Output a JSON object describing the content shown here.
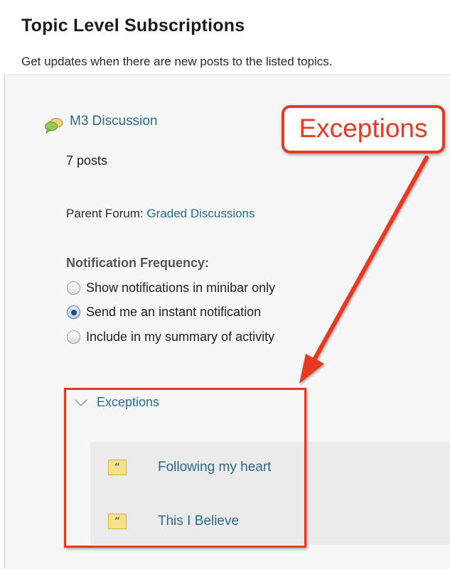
{
  "page": {
    "title": "Topic Level Subscriptions",
    "subtitle": "Get updates when there are new posts to the listed topics."
  },
  "topic": {
    "icon": "discussion-bubbles-icon",
    "name": "M3 Discussion",
    "post_count": "7 posts",
    "parent_forum_label": "Parent Forum:",
    "parent_forum_name": "Graded Discussions"
  },
  "notification": {
    "label": "Notification Frequency:",
    "options": [
      {
        "label": "Show notifications in minibar only",
        "checked": false
      },
      {
        "label": "Send me an instant notification",
        "checked": true
      },
      {
        "label": "Include in my summary of activity",
        "checked": false
      }
    ]
  },
  "exceptions": {
    "toggle_label": "Exceptions",
    "expanded": true,
    "items": [
      {
        "icon": "quote-icon",
        "label": "Following my heart"
      },
      {
        "icon": "quote-icon",
        "label": "This I Believe"
      }
    ]
  },
  "annotation": {
    "callout_text": "Exceptions",
    "color": "#e63a24"
  },
  "colors": {
    "link": "#2a6a8e",
    "accent": "#e63a24"
  }
}
